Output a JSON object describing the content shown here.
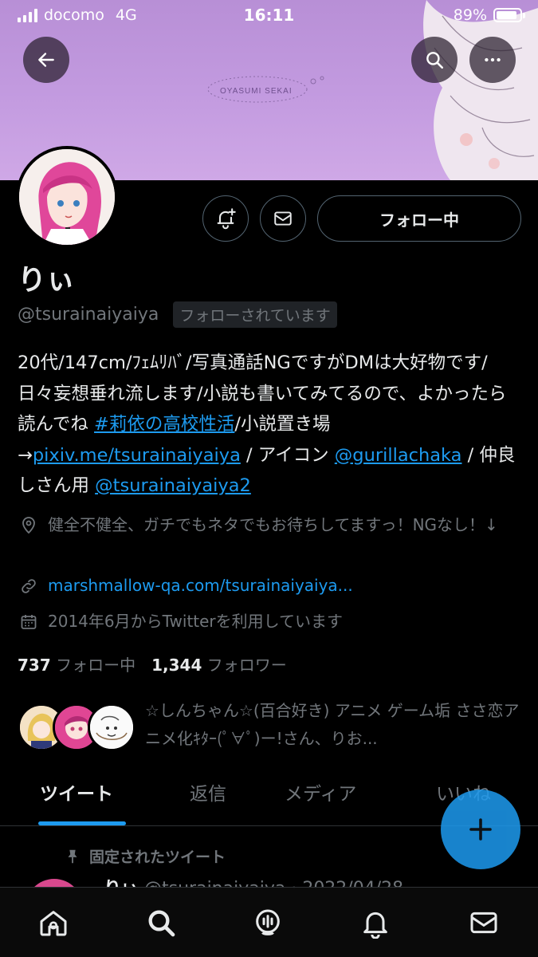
{
  "status_bar": {
    "carrier": "docomo",
    "network": "4G",
    "time": "16:11",
    "battery": "89%",
    "battery_level": 0.89
  },
  "banner": {
    "art_text": "OYASUMI SEKAI"
  },
  "actions": {
    "follow_label": "フォロー中"
  },
  "profile": {
    "name": "りぃ",
    "handle": "@tsurainaiyaiya",
    "follows_you": "フォローされています"
  },
  "bio": {
    "part1": "20代/147cm/ﾌｪﾑﾘﾊﾞ/写真通話NGですがDMは大好物です/日々妄想垂れ流します/小説も書いてみてるので、よかったら読んでね ",
    "hashtag": "#莉依の高校性活",
    "part2": "/小説置き場→",
    "pixiv_link": "pixiv.me/tsurainaiyaiya",
    "part3": " / アイコン ",
    "mention1": "@gurillachaka",
    "part4": " / 仲良しさん用 ",
    "mention2": "@tsurainaiyaiya2"
  },
  "meta": {
    "location": "健全不健全、ガチでもネタでもお待ちしてますっ！NGなし！↓",
    "url": "marshmallow-qa.com/tsurainaiyaiya...",
    "joined": "2014年6月からTwitterを利用しています"
  },
  "stats": {
    "following_count": "737",
    "following_label": "フォロー中",
    "followers_count": "1,344",
    "followers_label": "フォロワー"
  },
  "known_followers": "☆しんちゃん☆(百合好き) アニメ ゲーム垢 ささ恋アニメ化ｷﾀｰ(ﾟ∀ﾟ)ー!さん、りお...",
  "tabs": [
    "ツイート",
    "返信",
    "メディア",
    "いいね"
  ],
  "pinned": {
    "label": "固定されたツイート",
    "author": "りぃ",
    "handle_date": "@tsurainaiyaiya · 2022/04/28"
  },
  "colors": {
    "accent": "#1d9bf0",
    "banner": "#c39be0",
    "background": "#000000"
  }
}
